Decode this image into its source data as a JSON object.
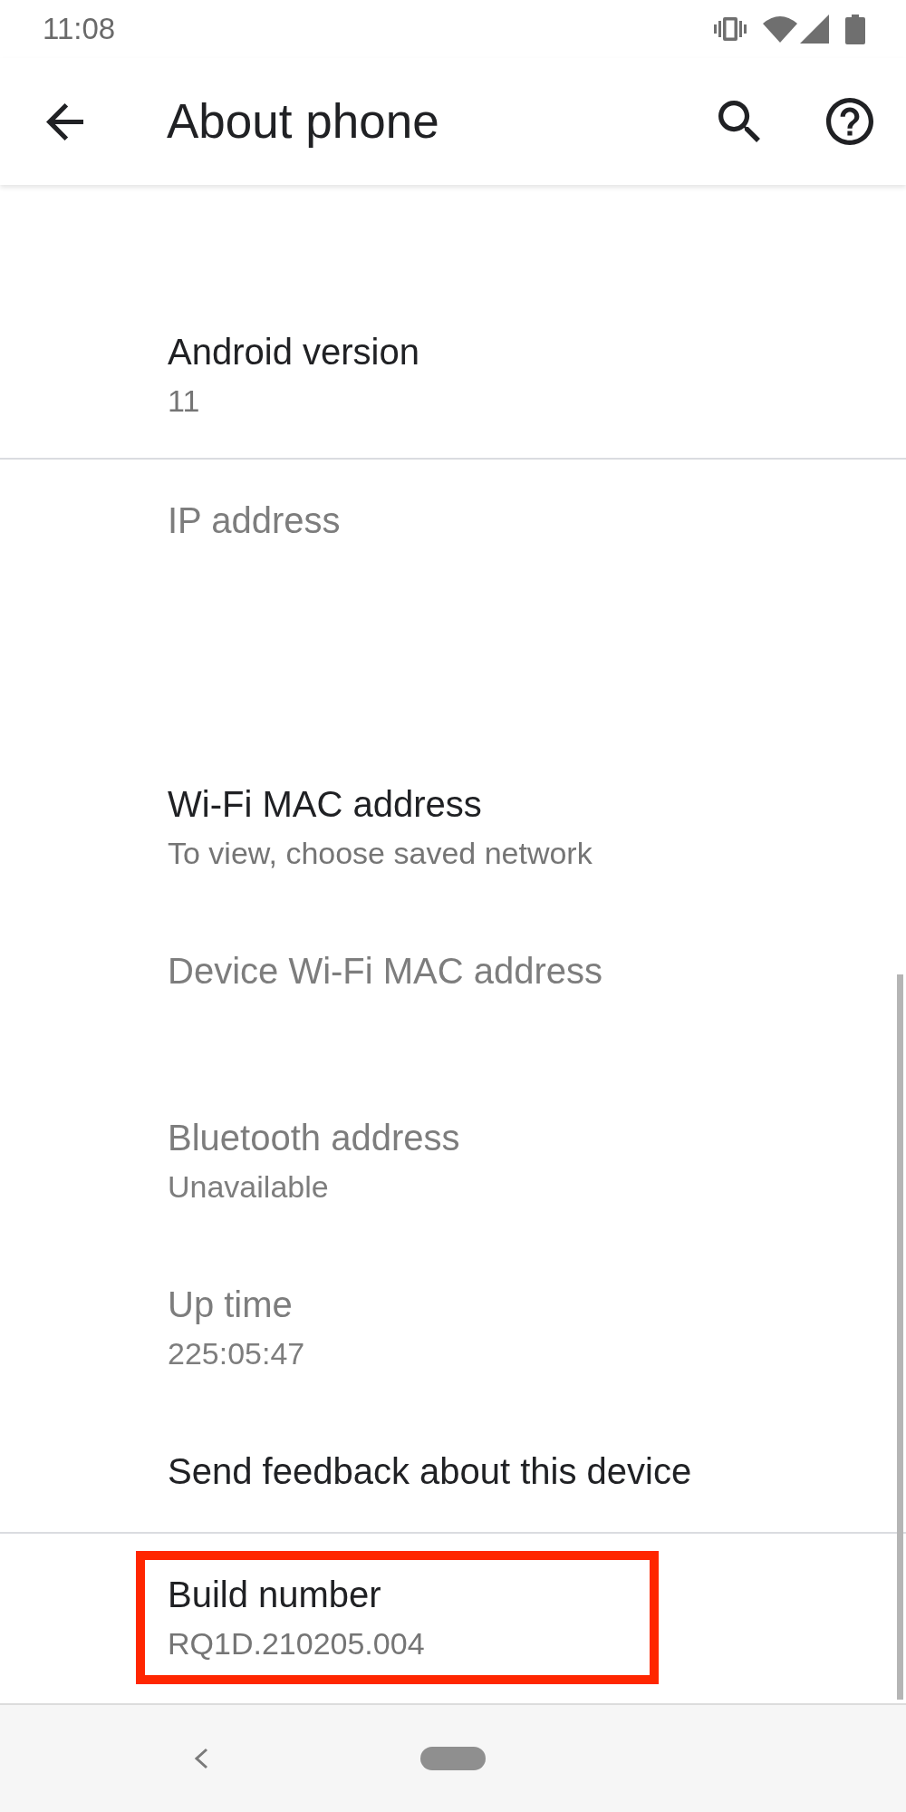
{
  "status_bar": {
    "time": "11:08"
  },
  "app_bar": {
    "title": "About phone"
  },
  "groups": [
    {
      "items": [
        {
          "kind": "value",
          "title": "Android version",
          "summary": "11",
          "disabled": false,
          "highlighted": false
        }
      ]
    },
    {
      "items": [
        {
          "kind": "multi_value",
          "title": "IP address",
          "disabled": true,
          "highlighted": false
        },
        {
          "kind": "value",
          "title": "Wi-Fi MAC address",
          "summary": "To view, choose saved network",
          "disabled": false,
          "highlighted": false
        },
        {
          "kind": "value",
          "title": "Device Wi-Fi MAC address",
          "disabled": true,
          "highlighted": false
        },
        {
          "kind": "value",
          "title": "Bluetooth address",
          "summary": "Unavailable",
          "disabled": true,
          "highlighted": false
        },
        {
          "kind": "value",
          "title": "Up time",
          "summary": "225:05:47",
          "disabled": true,
          "highlighted": false
        },
        {
          "kind": "link",
          "title": "Send feedback about this device",
          "disabled": false,
          "highlighted": false
        }
      ]
    },
    {
      "items": [
        {
          "kind": "value",
          "title": "Build number",
          "summary": "RQ1D.210205.004",
          "disabled": false,
          "highlighted": true
        }
      ]
    }
  ]
}
